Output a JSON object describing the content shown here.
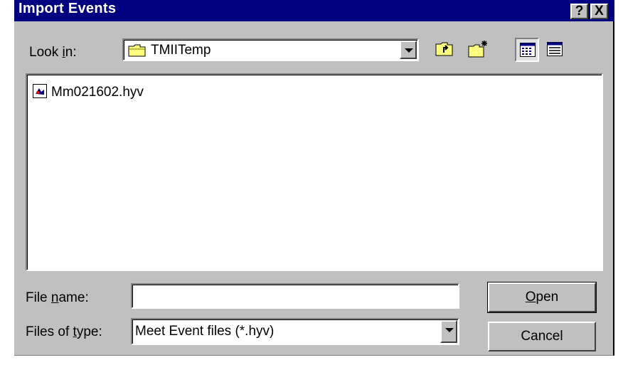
{
  "dialog": {
    "title": "Import Events",
    "help_button": "?",
    "close_button": "X"
  },
  "look_in": {
    "label_pre": "Look ",
    "label_accel": "i",
    "label_post": "n:",
    "value": "TMIITemp",
    "icon": "folder-icon"
  },
  "toolbar": {
    "up_one_level": "up-folder-icon",
    "new_folder": "new-folder-icon",
    "list_view": "list-view-icon",
    "details_view": "details-view-icon"
  },
  "files": [
    {
      "name": "Mm021602.hyv",
      "icon": "hyv-file-icon"
    }
  ],
  "file_name": {
    "label_pre": "File ",
    "label_accel": "n",
    "label_post": "ame:",
    "value": ""
  },
  "file_type": {
    "label_pre": "Files of ",
    "label_accel": "t",
    "label_post": "ype:",
    "value": "Meet Event files (*.hyv)"
  },
  "buttons": {
    "open_accel": "O",
    "open_rest": "pen",
    "cancel": "Cancel"
  }
}
